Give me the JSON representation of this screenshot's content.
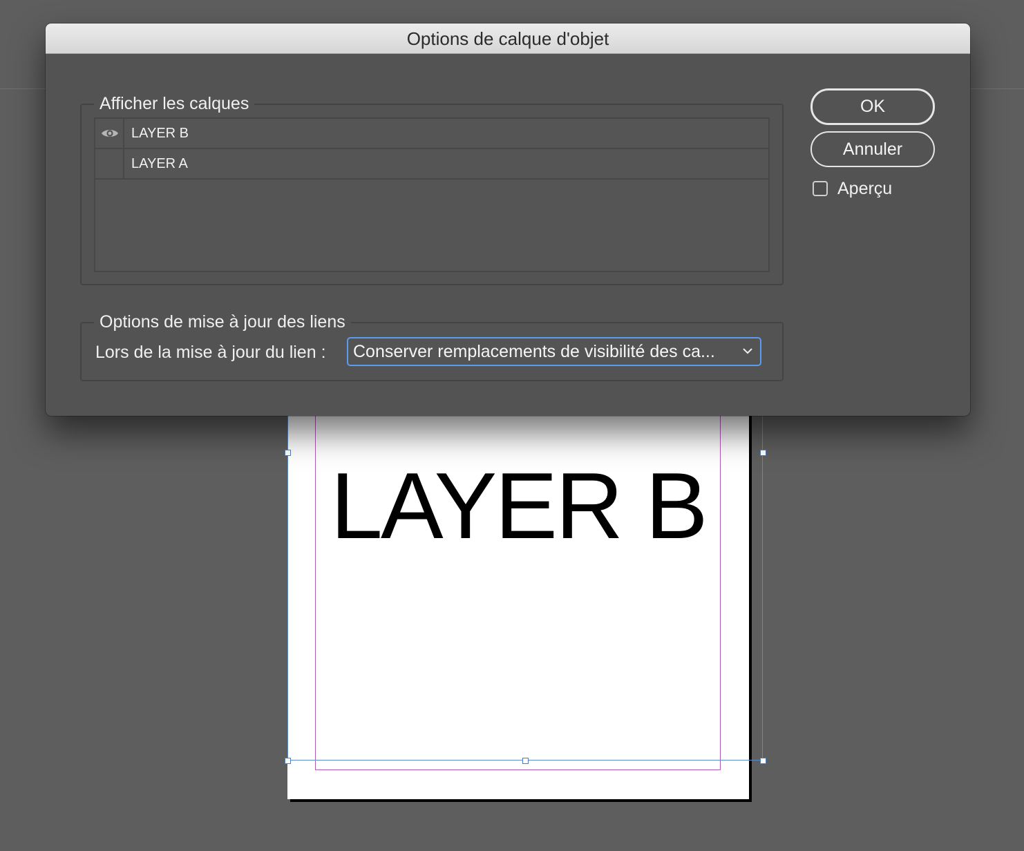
{
  "dialog": {
    "title": "Options de calque d'objet"
  },
  "layers_group": {
    "legend": "Afficher les calques",
    "layers": [
      {
        "name": "LAYER B",
        "visible": true,
        "icon": "eye-icon"
      },
      {
        "name": "LAYER A",
        "visible": false
      }
    ]
  },
  "links_group": {
    "legend": "Options de mise à jour des liens",
    "label": "Lors de la mise à jour du lien :",
    "selected": "Conserver remplacements de visibilité des ca..."
  },
  "buttons": {
    "ok": "OK",
    "cancel": "Annuler"
  },
  "preview": {
    "label": "Aperçu",
    "checked": false
  },
  "document": {
    "text": "LAYER B"
  },
  "colors": {
    "dialog_bg": "#535353",
    "canvas_bg": "#5e5e5e",
    "focus_ring": "#5b9cf0",
    "margin_guide": "#b25ab8",
    "selection": "#4a7fc2"
  }
}
